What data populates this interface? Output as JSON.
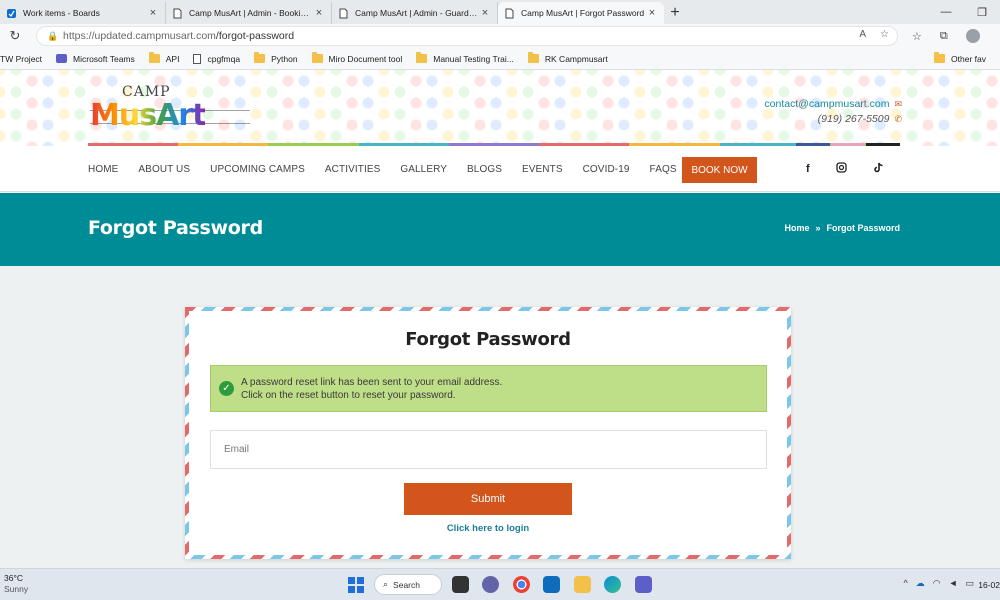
{
  "browser": {
    "tabs": [
      {
        "title": "Work items - Boards",
        "icon": "azure-boards-icon",
        "active": false
      },
      {
        "title": "Camp MusArt | Admin - Bookings",
        "icon": "page-icon",
        "active": false
      },
      {
        "title": "Camp MusArt | Admin - Guardians",
        "icon": "page-icon",
        "active": false
      },
      {
        "title": "Camp MusArt | Forgot Password",
        "icon": "page-icon",
        "active": true
      }
    ],
    "new_tab": "+",
    "url_host": "https://updated.campmusart.com",
    "url_path": "/forgot-password",
    "bookmarks": [
      {
        "label": "TW Project",
        "icon": "none"
      },
      {
        "label": "Microsoft Teams",
        "icon": "teams-icon"
      },
      {
        "label": "API",
        "icon": "folder-icon"
      },
      {
        "label": "cpgfmqa",
        "icon": "page-icon"
      },
      {
        "label": "Python",
        "icon": "folder-icon"
      },
      {
        "label": "Miro Document tool",
        "icon": "folder-icon"
      },
      {
        "label": "Manual Testing Trai...",
        "icon": "folder-icon"
      },
      {
        "label": "RK Campmusart",
        "icon": "folder-icon"
      }
    ],
    "other_favorites": "Other fav"
  },
  "site": {
    "logo_top": "CAMP",
    "logo_main": "MusArt",
    "email": "contact@campmusart.com",
    "phone": "(919) 267-5509",
    "nav": [
      "HOME",
      "ABOUT US",
      "UPCOMING CAMPS",
      "ACTIVITIES",
      "GALLERY",
      "BLOGS",
      "EVENTS",
      "COVID-19",
      "FAQS"
    ],
    "book_now": "BOOK NOW",
    "social": [
      "f",
      "instagram-icon",
      "tiktok-icon"
    ],
    "stripe_colors": [
      "#e36b6b",
      "#f4b740",
      "#9acb52",
      "#4ab3c6",
      "#8f7ad1",
      "#e36b6b",
      "#f4b740",
      "#4ab3c6",
      "#9acb52"
    ],
    "accent": "#d2561c",
    "teal": "#008c97"
  },
  "page": {
    "title": "Forgot Password",
    "breadcrumb_home": "Home",
    "breadcrumb_sep": "»",
    "breadcrumb_current": "Forgot Password"
  },
  "form": {
    "title": "Forgot Password",
    "alert_line1": "A password reset link has been sent to your email address.",
    "alert_line2": "Click on the reset button to reset your password.",
    "email_placeholder": "Email",
    "submit_label": "Submit",
    "login_link": "Click here to login"
  },
  "taskbar": {
    "temperature": "36°C",
    "condition": "Sunny",
    "search_label": "Search",
    "clock": "16-02"
  }
}
